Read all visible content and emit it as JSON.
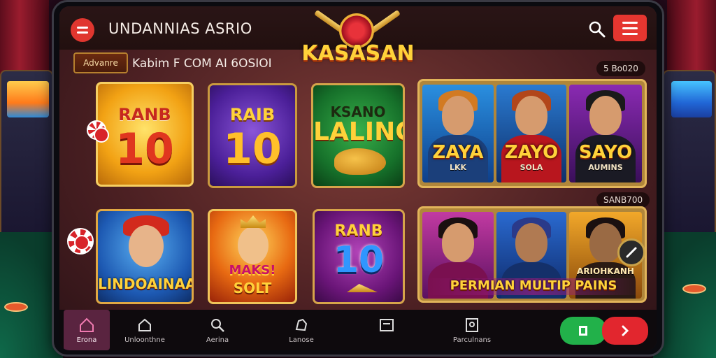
{
  "header": {
    "title": "UNDANNIAS ASRIO",
    "logo_text": "KASASAN"
  },
  "subbar": {
    "badge": "Advanre",
    "text": "Kabim F COM AI 6OSIOI",
    "count_top": "5 Bo020",
    "count_mid": "SANB700"
  },
  "games": {
    "tile1": {
      "top": "RANB",
      "num": "10"
    },
    "tile2": {
      "top": "RAIB",
      "num": "10"
    },
    "tile3": {
      "top": "KSANO",
      "title": "LALINO"
    },
    "tile5": {
      "title": "LINDOAINAA"
    },
    "tile6": {
      "top": "MAKS!",
      "bottom": "SOLT"
    },
    "tile7": {
      "top": "RANB",
      "num": "10"
    },
    "group1": [
      {
        "name": "ZAYA",
        "sub": "LKK"
      },
      {
        "name": "ZAYO",
        "sub": "SOLA"
      },
      {
        "name": "SAYO",
        "sub": "AUMINS"
      }
    ],
    "group2": {
      "caption": "ARIOHKANH",
      "banner": "PERMIAN MULTIP PAINS"
    }
  },
  "nav": {
    "items": [
      {
        "label": "Erona",
        "icon": "home-icon"
      },
      {
        "label": "Unloonthne",
        "icon": "house-outline-icon"
      },
      {
        "label": "Aerina",
        "icon": "search-icon"
      },
      {
        "label": "Lanose",
        "icon": "hand-icon"
      },
      {
        "label": "",
        "icon": "card-icon"
      },
      {
        "label": "Parculnans",
        "icon": "slot-machine-icon"
      }
    ]
  },
  "colors": {
    "accent_red": "#e53630",
    "accent_gold": "#ffd23a",
    "nav_active": "#5a2440",
    "go_green": "#22b14a"
  }
}
